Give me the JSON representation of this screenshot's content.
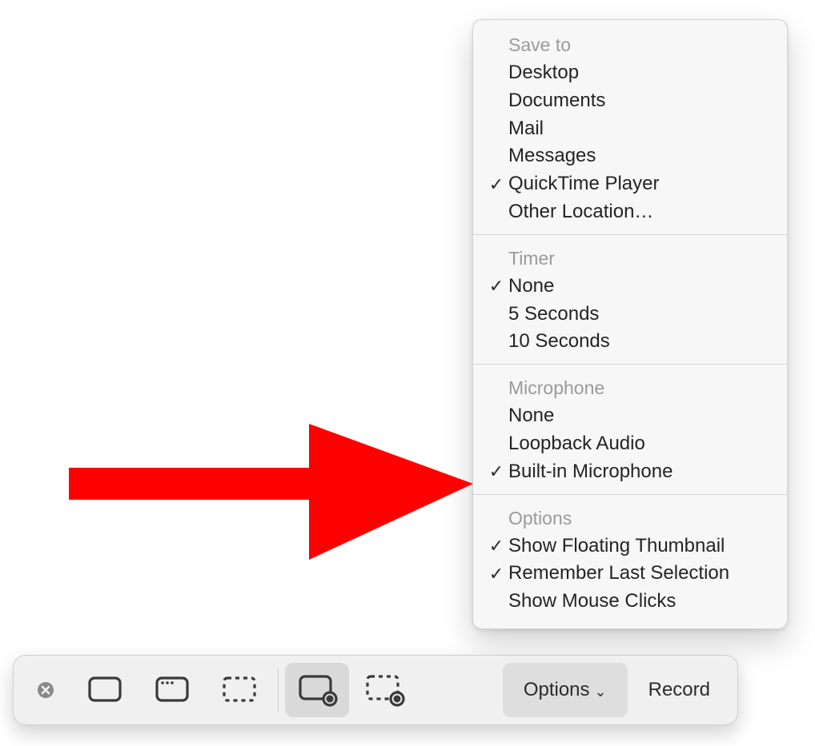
{
  "menu": {
    "sections": [
      {
        "header": "Save to",
        "items": [
          {
            "label": "Desktop",
            "checked": false
          },
          {
            "label": "Documents",
            "checked": false
          },
          {
            "label": "Mail",
            "checked": false
          },
          {
            "label": "Messages",
            "checked": false
          },
          {
            "label": "QuickTime Player",
            "checked": true
          },
          {
            "label": "Other Location…",
            "checked": false
          }
        ]
      },
      {
        "header": "Timer",
        "items": [
          {
            "label": "None",
            "checked": true
          },
          {
            "label": "5 Seconds",
            "checked": false
          },
          {
            "label": "10 Seconds",
            "checked": false
          }
        ]
      },
      {
        "header": "Microphone",
        "items": [
          {
            "label": "None",
            "checked": false
          },
          {
            "label": "Loopback Audio",
            "checked": false
          },
          {
            "label": "Built-in Microphone",
            "checked": true
          }
        ]
      },
      {
        "header": "Options",
        "items": [
          {
            "label": "Show Floating Thumbnail",
            "checked": true
          },
          {
            "label": "Remember Last Selection",
            "checked": true
          },
          {
            "label": "Show Mouse Clicks",
            "checked": false
          }
        ]
      }
    ]
  },
  "toolbar": {
    "options_label": "Options",
    "record_label": "Record",
    "active_mode": "record-entire-screen"
  },
  "annotation": {
    "arrow_color": "#ff0000"
  }
}
